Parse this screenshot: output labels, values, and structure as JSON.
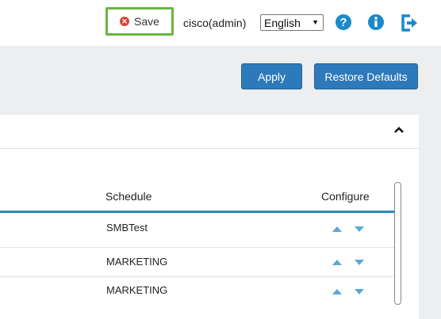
{
  "header": {
    "save_label": "Save",
    "user": "cisco(admin)",
    "language": "English"
  },
  "toolbar": {
    "apply_label": "Apply",
    "restore_label": "Restore Defaults"
  },
  "table": {
    "columns": [
      "Schedule",
      "Configure"
    ],
    "rows": [
      {
        "schedule": "SMBTest"
      },
      {
        "schedule": "MARKETING"
      },
      {
        "schedule": "MARKETING"
      }
    ]
  },
  "colors": {
    "highlight": "#6ab542",
    "primary": "#2d79b9",
    "accent": "#2a8ab7",
    "arrow": "#5aa9d6"
  }
}
